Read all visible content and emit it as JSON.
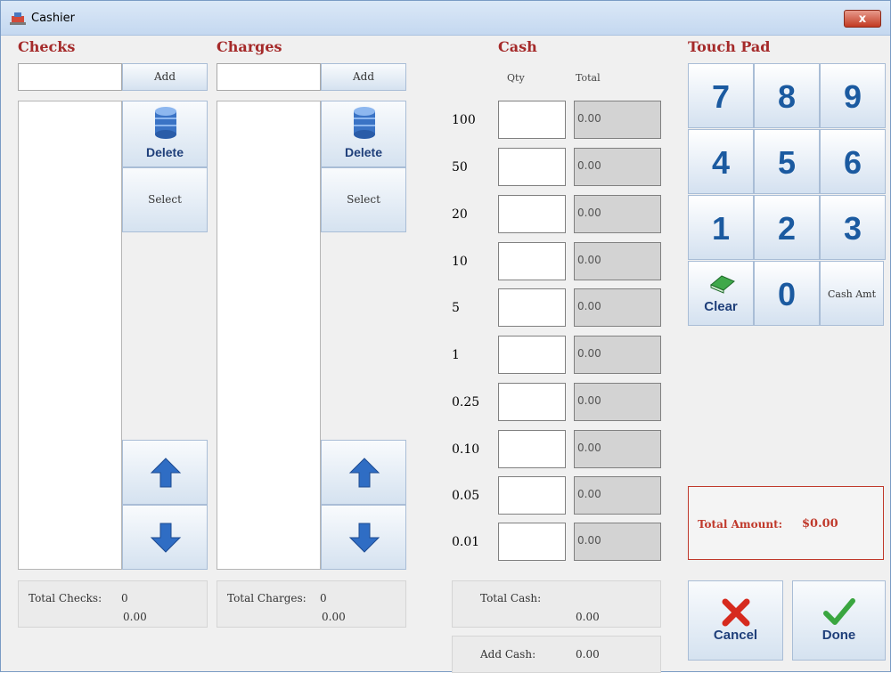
{
  "window": {
    "title": "Cashier",
    "close_label": "x"
  },
  "checks": {
    "title": "Checks",
    "add_label": "Add",
    "delete_label": "Delete",
    "select_label": "Select",
    "total_label": "Total Checks:",
    "total_count": "0",
    "total_value": "0.00"
  },
  "charges": {
    "title": "Charges",
    "add_label": "Add",
    "delete_label": "Delete",
    "select_label": "Select",
    "total_label": "Total Charges:",
    "total_count": "0",
    "total_value": "0.00"
  },
  "cash": {
    "title": "Cash",
    "qty_header": "Qty",
    "total_header": "Total",
    "rows": [
      {
        "denomination": "100",
        "qty": "",
        "total": "0.00"
      },
      {
        "denomination": "50",
        "qty": "",
        "total": "0.00"
      },
      {
        "denomination": "20",
        "qty": "",
        "total": "0.00"
      },
      {
        "denomination": "10",
        "qty": "",
        "total": "0.00"
      },
      {
        "denomination": "5",
        "qty": "",
        "total": "0.00"
      },
      {
        "denomination": "1",
        "qty": "",
        "total": "0.00"
      },
      {
        "denomination": "0.25",
        "qty": "",
        "total": "0.00"
      },
      {
        "denomination": "0.10",
        "qty": "",
        "total": "0.00"
      },
      {
        "denomination": "0.05",
        "qty": "",
        "total": "0.00"
      },
      {
        "denomination": "0.01",
        "qty": "",
        "total": "0.00"
      }
    ],
    "total_cash_label": "Total Cash:",
    "total_cash_value": "0.00",
    "add_cash_label": "Add Cash:",
    "add_cash_value": "0.00"
  },
  "touch_pad": {
    "title": "Touch Pad",
    "keys": [
      "7",
      "8",
      "9",
      "4",
      "5",
      "6",
      "1",
      "2",
      "3"
    ],
    "clear_label": "Clear",
    "zero_label": "0",
    "cash_amt_label": "Cash Amt"
  },
  "total_amount": {
    "label": "Total Amount:",
    "value": "$0.00"
  },
  "actions": {
    "cancel_label": "Cancel",
    "done_label": "Done"
  },
  "icons": {
    "app": "cashier-app-icon",
    "delete": "database-delete-icon",
    "up": "arrow-up-icon",
    "down": "arrow-down-icon",
    "clear": "eraser-icon",
    "cancel": "red-x-icon",
    "done": "green-check-icon"
  }
}
